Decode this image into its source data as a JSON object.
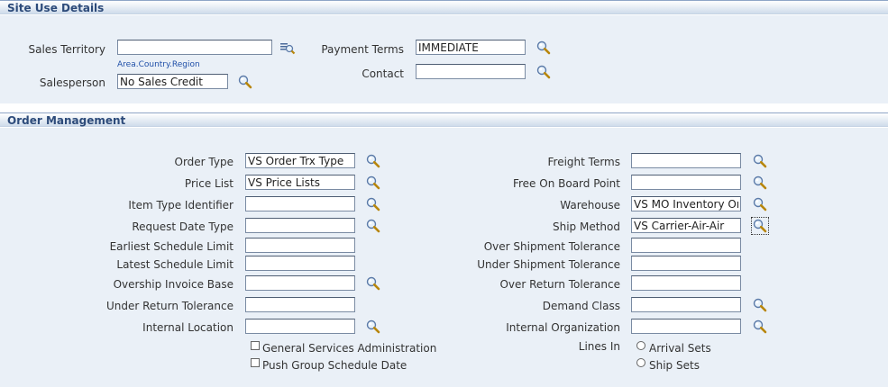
{
  "site_use": {
    "title": "Site Use Details",
    "sales_territory_label": "Sales Territory",
    "sales_territory_value": "",
    "sales_territory_hint": "Area.Country.Region",
    "salesperson_label": "Salesperson",
    "salesperson_value": "No Sales Credit",
    "payment_terms_label": "Payment Terms",
    "payment_terms_value": "IMMEDIATE",
    "contact_label": "Contact",
    "contact_value": ""
  },
  "order_mgmt": {
    "title": "Order Management",
    "left": [
      {
        "label": "Order Type",
        "value": "VS Order Trx Type",
        "lov": true
      },
      {
        "label": "Price List",
        "value": "VS Price Lists",
        "lov": true
      },
      {
        "label": "Item Type Identifier",
        "value": "",
        "lov": true
      },
      {
        "label": "Request Date Type",
        "value": "",
        "lov": true
      },
      {
        "label": "Earliest Schedule Limit",
        "value": "",
        "lov": false
      },
      {
        "label": "Latest Schedule Limit",
        "value": "",
        "lov": false
      },
      {
        "label": "Overship Invoice Base",
        "value": "",
        "lov": true
      },
      {
        "label": "Under Return Tolerance",
        "value": "",
        "lov": false
      },
      {
        "label": "Internal Location",
        "value": "",
        "lov": true
      }
    ],
    "right": [
      {
        "label": "Freight Terms",
        "value": "",
        "lov": true
      },
      {
        "label": "Free On Board Point",
        "value": "",
        "lov": true
      },
      {
        "label": "Warehouse",
        "value": "VS MO Inventory Org",
        "lov": true
      },
      {
        "label": "Ship Method",
        "value": "VS Carrier-Air-Air",
        "lov": true
      },
      {
        "label": "Over Shipment Tolerance",
        "value": "",
        "lov": false
      },
      {
        "label": "Under Shipment Tolerance",
        "value": "",
        "lov": false
      },
      {
        "label": "Over Return Tolerance",
        "value": "",
        "lov": false
      },
      {
        "label": "Demand Class",
        "value": "",
        "lov": true
      },
      {
        "label": "Internal Organization",
        "value": "",
        "lov": true
      }
    ],
    "checkboxes": [
      {
        "label": "General Services Administration",
        "checked": false
      },
      {
        "label": "Push Group Schedule Date",
        "checked": false
      }
    ],
    "lines_in_label": "Lines In",
    "radios": [
      {
        "label": "Arrival Sets",
        "selected": false
      },
      {
        "label": "Ship Sets",
        "selected": false
      }
    ]
  }
}
